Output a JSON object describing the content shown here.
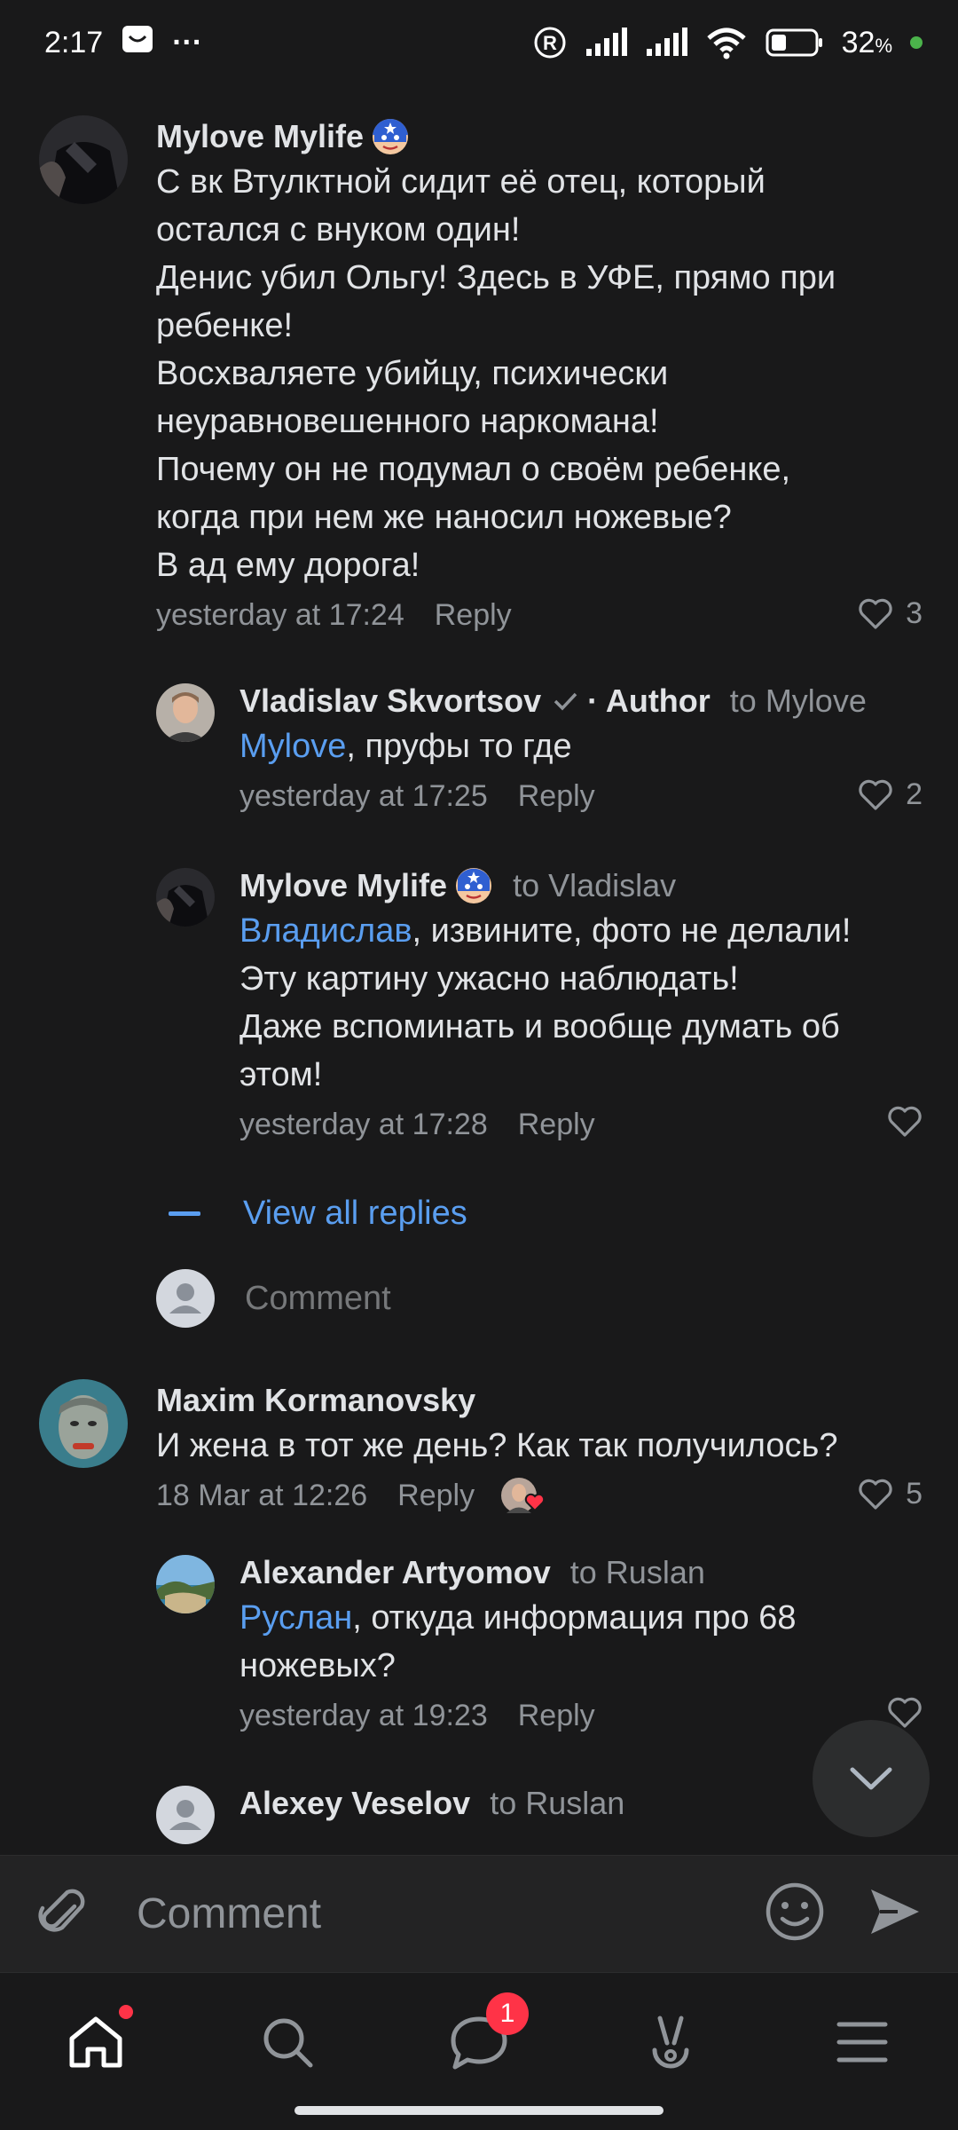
{
  "status_bar": {
    "time": "2:17",
    "dots": "···",
    "battery": "32",
    "battery_unit": "%"
  },
  "comments": {
    "c1": {
      "name": "Mylove Mylife",
      "text": "С вк Втулктной сидит её отец, который\nостался с внуком один!\nДенис убил Ольгу! Здесь в УФЕ, прямо при\nребенке!\nВосхваляете убийцу, психически\nнеуравновешенного наркомана!\nПочему он не подумал о своём ребенке,\nкогда при нем же наносил ножевые?\nВ ад ему дорога!",
      "time": "yesterday at 17:24",
      "reply": "Reply",
      "likes": "3"
    },
    "c2": {
      "name": "Vladislav Skvortsov",
      "author": "· Author",
      "to": "to Mylove",
      "mention": "Mylove",
      "text": ", пруфы то где",
      "time": "yesterday at 17:25",
      "reply": "Reply",
      "likes": "2"
    },
    "c3": {
      "name": "Mylove Mylife",
      "to": "to Vladislav",
      "mention": "Владислав",
      "text": ", извините, фото не делали!\nЭту картину ужасно наблюдать!\nДаже вспоминать и вообще думать об\nэтом!",
      "time": "yesterday at 17:28",
      "reply": "Reply"
    },
    "view_all": "View all replies",
    "comment_placeholder": "Comment",
    "c4": {
      "name": "Maxim Kormanovsky",
      "text": "И жена в тот же день? Как так получилось?",
      "time": "18 Mar at 12:26",
      "reply": "Reply",
      "likes": "5"
    },
    "c5": {
      "name": "Alexander Artyomov",
      "to": "to Ruslan",
      "mention": "Руслан",
      "text": ", откуда информация про 68\nножевых?",
      "time": "yesterday at 19:23",
      "reply": "Reply"
    },
    "c6": {
      "name": "Alexey Veselov",
      "to": "to Ruslan"
    }
  },
  "composer": {
    "placeholder": "Comment"
  },
  "tabbar": {
    "messages_badge": "1"
  },
  "colors": {
    "accent": "#5a9ef0",
    "badge": "#ff3347",
    "background": "#19191a"
  }
}
